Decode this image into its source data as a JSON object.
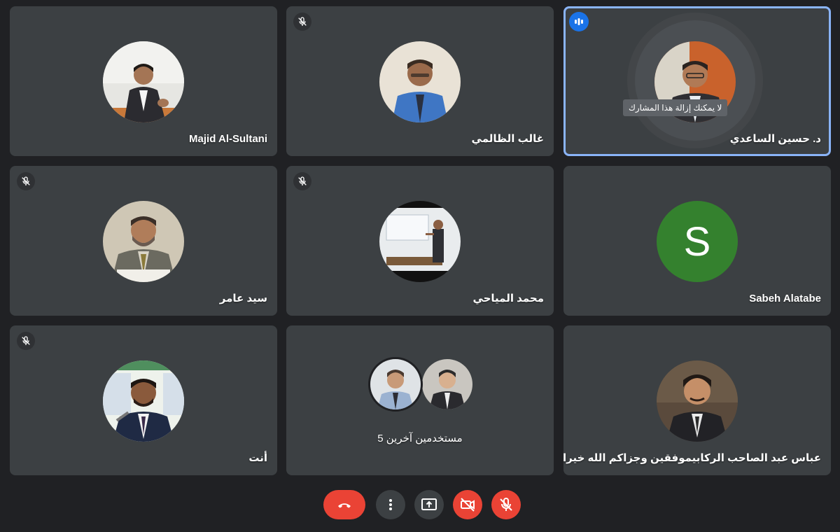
{
  "participants": [
    {
      "name": "Majid Al-Sultani",
      "muted": false
    },
    {
      "name": "غالب الظالمي",
      "muted": true
    },
    {
      "name": "د. حسين الساعدي",
      "muted": false,
      "speaking": true,
      "tooltip": "لا يمكنك إزالة هذا المشارك"
    },
    {
      "name": "سيد عامر",
      "muted": true
    },
    {
      "name": "محمد المياحي",
      "muted": true
    },
    {
      "name": "Sabeh Alatabe",
      "initial": "S",
      "muted": false
    },
    {
      "name": "أنت",
      "muted": true
    },
    {
      "name": "5 مستخدمين آخرين",
      "muted": false
    },
    {
      "name": "عباس عبد الصاحب الركابيموفقين وجزاكم الله خيرا",
      "muted": false
    }
  ],
  "controls": {
    "end_call": "leave-call",
    "more": "more-options",
    "present": "present-now",
    "camera": "camera-off",
    "mic": "microphone-off"
  },
  "colors": {
    "background": "#202124",
    "tile": "#3c4043",
    "speaking_border": "#8ab4f8",
    "danger": "#ea4335",
    "avatar_green": "#34812e"
  }
}
